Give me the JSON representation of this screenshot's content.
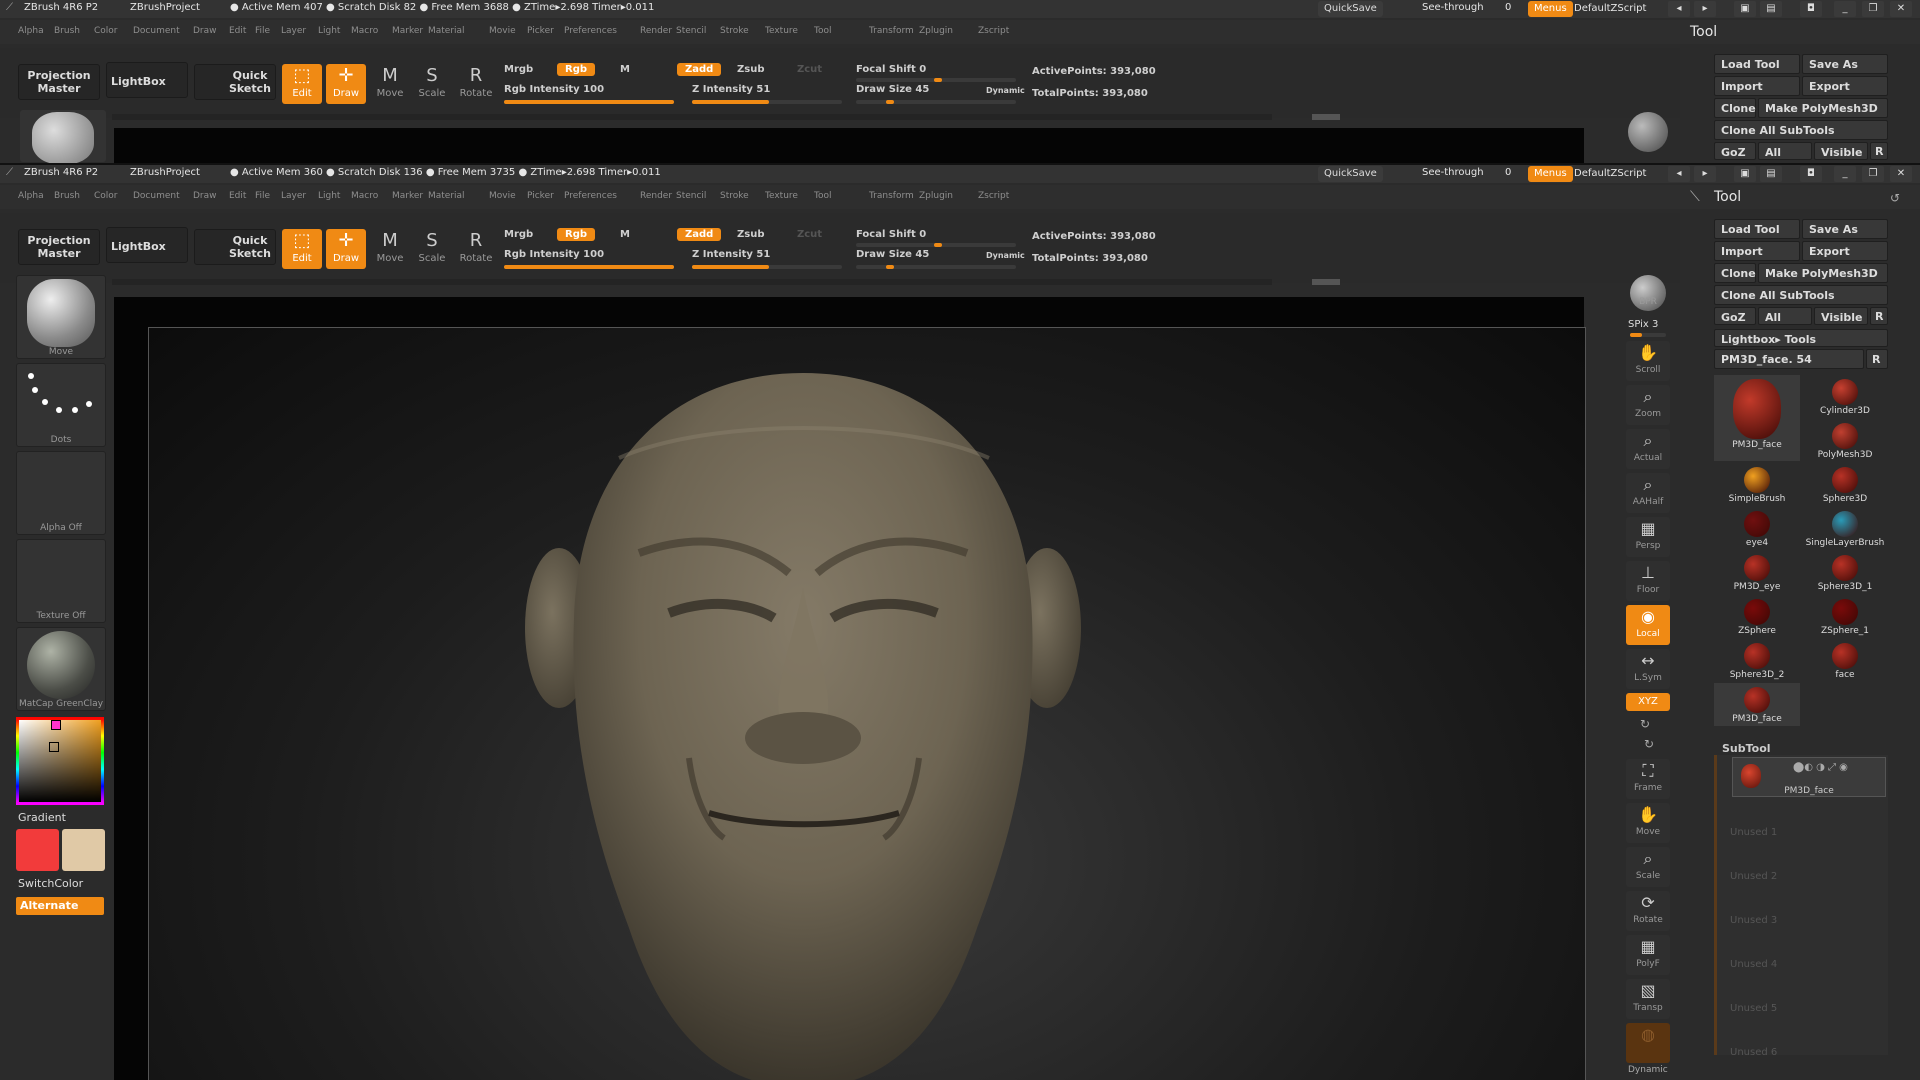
{
  "title_bar": {
    "app": "ZBrush 4R6 P2",
    "project": "ZBrushProject",
    "status_a": "● Active Mem 407 ● Scratch Disk 82 ● Free Mem 3688 ● ZTime▸2.698 Timer▸0.011",
    "status_b": "● Active Mem 360 ● Scratch Disk 136 ● Free Mem 3735 ● ZTime▸2.698 Timer▸0.011",
    "quicksave": "QuickSave",
    "see_through": "See-through",
    "see_through_value": "0",
    "menus": "Menus",
    "default_script": "DefaultZScript"
  },
  "menu_items": [
    "Alpha",
    "Brush",
    "Color",
    "Document",
    "Draw",
    "Edit",
    "File",
    "Layer",
    "Light",
    "Macro",
    "Marker",
    "Material",
    "Movie",
    "Picker",
    "Preferences",
    "Render",
    "Stencil",
    "Stroke",
    "Texture",
    "Tool",
    "Transform",
    "Zplugin",
    "Zscript"
  ],
  "top_shelf": {
    "projection_master": "Projection Master",
    "lightbox": "LightBox",
    "quick_sketch": "Quick Sketch",
    "edit": "Edit",
    "draw": "Draw",
    "move": "Move",
    "scale": "Scale",
    "rotate": "Rotate",
    "mrgb": "Mrgb",
    "rgb": "Rgb",
    "m": "M",
    "zadd": "Zadd",
    "zsub": "Zsub",
    "zcut": "Zcut",
    "rgb_intensity": "Rgb Intensity 100",
    "rgb_intensity_level": 1.0,
    "z_intensity": "Z Intensity 51",
    "z_intensity_level": 0.51,
    "focal_shift": "Focal Shift 0",
    "draw_size": "Draw Size 45",
    "dynamic": "Dynamic",
    "active_points": "ActivePoints: 393,080",
    "total_points": "TotalPoints: 393,080"
  },
  "left_shelf": {
    "brush": "Move",
    "stroke": "Dots",
    "alpha": "Alpha Off",
    "texture": "Texture Off",
    "material": "MatCap GreenClay",
    "gradient": "Gradient",
    "switch_color": "SwitchColor",
    "alternate": "Alternate",
    "main_color": "#f23b3b",
    "secondary_color": "#e0c9a6"
  },
  "right_shelf": {
    "bpr": "BPR",
    "spix": "SPix 3",
    "scroll": "Scroll",
    "zoom": "Zoom",
    "actual": "Actual",
    "aahalf": "AAHalf",
    "persp": "Persp",
    "floor": "Floor",
    "local": "Local",
    "lsym": "L.Sym",
    "xyz": "XYZ",
    "frame": "Frame",
    "move": "Move",
    "scale": "Scale",
    "rotate": "Rotate",
    "polyf": "PolyF",
    "transp": "Transp",
    "dynamic": "Dynamic"
  },
  "tool_palette": {
    "header": "Tool",
    "load_tool": "Load Tool",
    "save_as": "Save As",
    "import": "Import",
    "export": "Export",
    "clone": "Clone",
    "make_polymesh": "Make PolyMesh3D",
    "clone_all": "Clone All SubTools",
    "goz": "GoZ",
    "all": "All",
    "visible": "Visible",
    "r": "R",
    "lightbox_tools": "Lightbox▸ Tools",
    "current_tool": "PM3D_face. 54",
    "tools": [
      {
        "name": "PM3D_face"
      },
      {
        "name": "Cylinder3D"
      },
      {
        "name": "PolyMesh3D"
      },
      {
        "name": "SimpleBrush"
      },
      {
        "name": "Sphere3D"
      },
      {
        "name": "eye4"
      },
      {
        "name": "SingleLayerBrush"
      },
      {
        "name": "PM3D_eye"
      },
      {
        "name": "Sphere3D_1"
      },
      {
        "name": "ZSphere"
      },
      {
        "name": "ZSphere_1"
      },
      {
        "name": "Sphere3D_2"
      },
      {
        "name": "face"
      },
      {
        "name": "PM3D_face"
      }
    ],
    "subtool_header": "SubTool",
    "subtool_active": "PM3D_face",
    "unused": [
      "Unused 1",
      "Unused 2",
      "Unused 3",
      "Unused 4",
      "Unused 5",
      "Unused 6"
    ]
  }
}
